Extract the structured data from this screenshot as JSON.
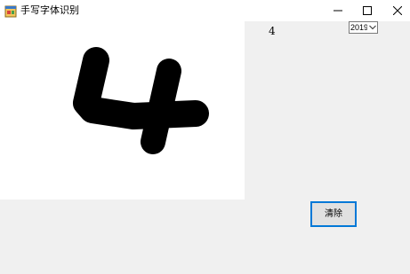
{
  "window": {
    "title": "手写字体识别",
    "icon": "app-form-icon",
    "controls": [
      "minimize-icon",
      "maximize-icon",
      "close-icon"
    ]
  },
  "result": {
    "predicted_digit": "4"
  },
  "model_select": {
    "value": "2019",
    "icon": "chevron-down-icon"
  },
  "actions": {
    "clear_label": "清除"
  },
  "drawing": {
    "stroke_color": "#000000",
    "canvas_color": "#ffffff"
  }
}
